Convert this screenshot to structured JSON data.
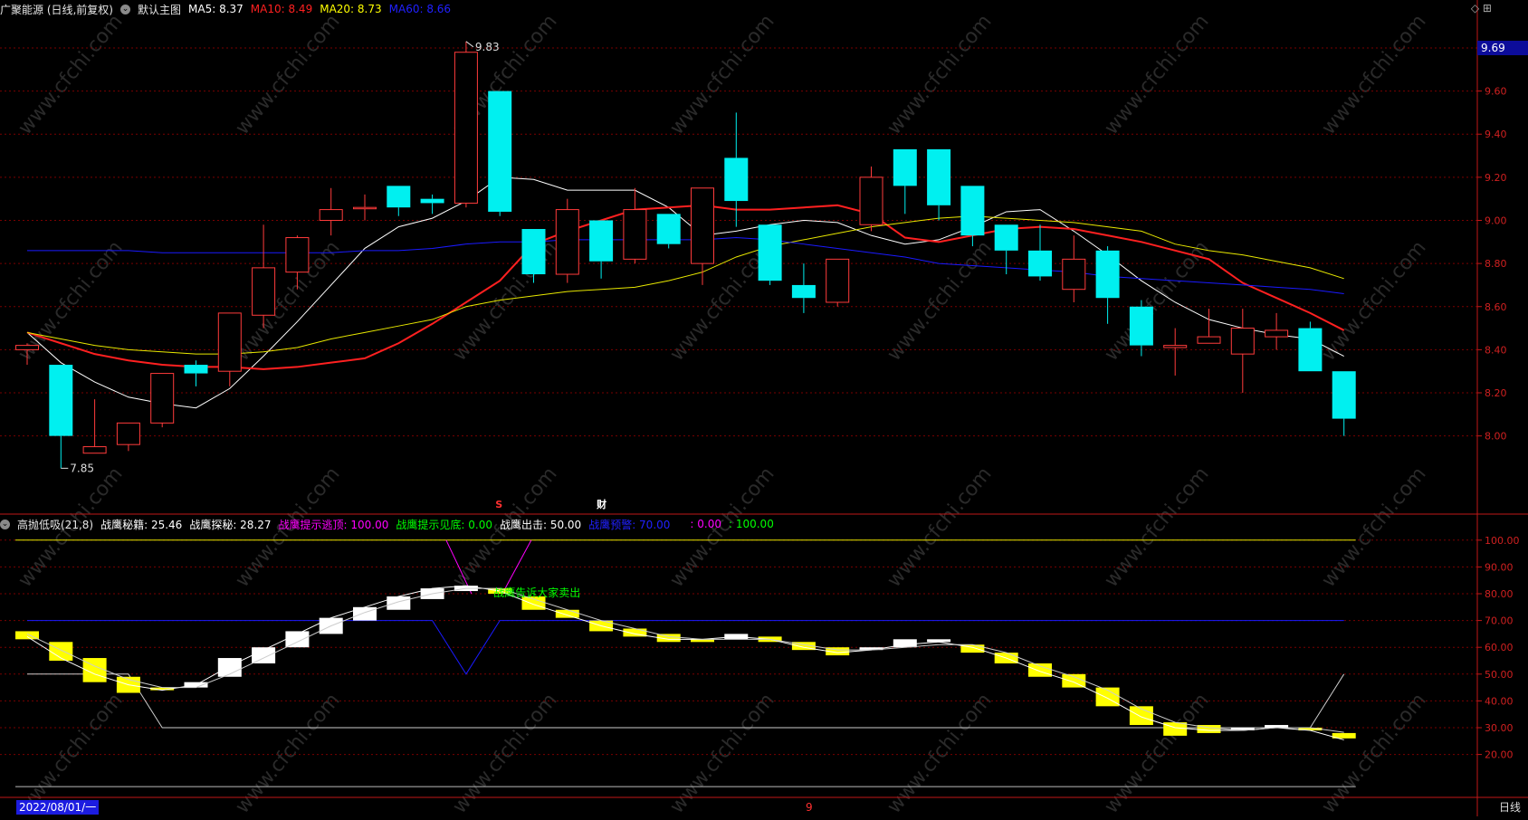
{
  "header": {
    "stock_title": "广聚能源 (日线,前复权)",
    "main_chart_label": "默认主图",
    "ma": [
      {
        "label": "MA5: 8.37",
        "color": "#ffffff"
      },
      {
        "label": "MA10: 8.49",
        "color": "#ff2020"
      },
      {
        "label": "MA20: 8.73",
        "color": "#ffff00"
      },
      {
        "label": "MA60: 8.66",
        "color": "#2020ff"
      }
    ]
  },
  "indicator_header": {
    "name": "高抛低吸(21,8)",
    "items": [
      {
        "label": "战鹰秘籍: 25.46",
        "color": "#ffffff"
      },
      {
        "label": "战鹰探秘: 28.27",
        "color": "#ffffff"
      },
      {
        "label": "战鹰提示逃顶: 100.00",
        "color": "#ff00ff"
      },
      {
        "label": "战鹰提示见底: 0.00",
        "color": "#00ff00"
      },
      {
        "label": "战鹰出击: 50.00",
        "color": "#ffffff"
      },
      {
        "label": "战鹰预警: 70.00",
        "color": "#2020ff"
      },
      {
        "label": ": 0.00",
        "color": "#ff00ff"
      },
      {
        "label": ": 100.00",
        "color": "#00ff00"
      }
    ]
  },
  "footer": {
    "date": "2022/08/01/一",
    "period": "日线",
    "month_mark": "9"
  },
  "current_price_tag": "9.69",
  "top_icons": "◇ ⊞",
  "watermark": "www.cfchi.com",
  "colors": {
    "up": "#ff3b3b",
    "down": "#00f0f0",
    "grid": "#7a0000",
    "axis": "#c01818",
    "ma5": "#ffffff",
    "ma10": "#ff2020",
    "ma20": "#e8e800",
    "ma60": "#1a1aff"
  },
  "chart_data": [
    {
      "type": "candlestick",
      "title": "广聚能源 (日线,前复权)",
      "ylim": [
        7.65,
        9.93
      ],
      "yticks": [
        8.0,
        8.2,
        8.4,
        8.6,
        8.8,
        9.0,
        9.2,
        9.4,
        9.6,
        9.8
      ],
      "annotations": [
        {
          "text": "9.83",
          "index": 13,
          "value": 9.83,
          "kind": "high"
        },
        {
          "text": "7.85",
          "index": 1,
          "value": 7.85,
          "kind": "low"
        },
        {
          "text": "S",
          "index": 14,
          "color": "#ff3030"
        },
        {
          "text": "财",
          "index": 17,
          "color": "#ffffff"
        }
      ],
      "ohlc": [
        {
          "o": 8.4,
          "h": 8.43,
          "l": 8.33,
          "c": 8.42
        },
        {
          "o": 8.33,
          "h": 8.33,
          "l": 7.85,
          "c": 8.0
        },
        {
          "o": 7.92,
          "h": 8.17,
          "l": 7.92,
          "c": 7.95
        },
        {
          "o": 7.96,
          "h": 8.06,
          "l": 7.93,
          "c": 8.06
        },
        {
          "o": 8.06,
          "h": 8.29,
          "l": 8.04,
          "c": 8.29
        },
        {
          "o": 8.33,
          "h": 8.35,
          "l": 8.23,
          "c": 8.29
        },
        {
          "o": 8.3,
          "h": 8.57,
          "l": 8.23,
          "c": 8.57
        },
        {
          "o": 8.56,
          "h": 8.98,
          "l": 8.5,
          "c": 8.78
        },
        {
          "o": 8.76,
          "h": 8.93,
          "l": 8.68,
          "c": 8.92
        },
        {
          "o": 9.0,
          "h": 9.15,
          "l": 8.93,
          "c": 9.05
        },
        {
          "o": 9.06,
          "h": 9.12,
          "l": 9.0,
          "c": 9.06
        },
        {
          "o": 9.16,
          "h": 9.16,
          "l": 9.02,
          "c": 9.06
        },
        {
          "o": 9.1,
          "h": 9.12,
          "l": 9.03,
          "c": 9.08
        },
        {
          "o": 9.08,
          "h": 9.83,
          "l": 9.06,
          "c": 9.78
        },
        {
          "o": 9.6,
          "h": 9.6,
          "l": 9.02,
          "c": 9.04
        },
        {
          "o": 8.96,
          "h": 8.96,
          "l": 8.71,
          "c": 8.75
        },
        {
          "o": 8.75,
          "h": 9.1,
          "l": 8.71,
          "c": 9.05
        },
        {
          "o": 9.0,
          "h": 9.0,
          "l": 8.73,
          "c": 8.81
        },
        {
          "o": 8.82,
          "h": 9.15,
          "l": 8.8,
          "c": 9.05
        },
        {
          "o": 9.03,
          "h": 9.03,
          "l": 8.87,
          "c": 8.89
        },
        {
          "o": 8.8,
          "h": 9.15,
          "l": 8.7,
          "c": 9.15
        },
        {
          "o": 9.29,
          "h": 9.5,
          "l": 8.97,
          "c": 9.09
        },
        {
          "o": 8.98,
          "h": 8.98,
          "l": 8.7,
          "c": 8.72
        },
        {
          "o": 8.7,
          "h": 8.8,
          "l": 8.57,
          "c": 8.64
        },
        {
          "o": 8.62,
          "h": 8.82,
          "l": 8.6,
          "c": 8.82
        },
        {
          "o": 8.98,
          "h": 9.25,
          "l": 8.95,
          "c": 9.2
        },
        {
          "o": 9.33,
          "h": 9.33,
          "l": 9.03,
          "c": 9.16
        },
        {
          "o": 9.33,
          "h": 9.33,
          "l": 9.0,
          "c": 9.07
        },
        {
          "o": 9.16,
          "h": 9.16,
          "l": 8.88,
          "c": 8.93
        },
        {
          "o": 8.98,
          "h": 8.98,
          "l": 8.75,
          "c": 8.86
        },
        {
          "o": 8.86,
          "h": 8.98,
          "l": 8.72,
          "c": 8.74
        },
        {
          "o": 8.68,
          "h": 8.93,
          "l": 8.62,
          "c": 8.82
        },
        {
          "o": 8.86,
          "h": 8.88,
          "l": 8.52,
          "c": 8.64
        },
        {
          "o": 8.6,
          "h": 8.63,
          "l": 8.37,
          "c": 8.42
        },
        {
          "o": 8.41,
          "h": 8.5,
          "l": 8.28,
          "c": 8.42
        },
        {
          "o": 8.43,
          "h": 8.59,
          "l": 8.43,
          "c": 8.46
        },
        {
          "o": 8.38,
          "h": 8.59,
          "l": 8.2,
          "c": 8.5
        },
        {
          "o": 8.46,
          "h": 8.57,
          "l": 8.4,
          "c": 8.49
        },
        {
          "o": 8.5,
          "h": 8.53,
          "l": 8.3,
          "c": 8.3
        },
        {
          "o": 8.3,
          "h": 8.3,
          "l": 8.0,
          "c": 8.08
        }
      ],
      "series": [
        {
          "name": "MA5",
          "color": "#ffffff",
          "values": [
            8.48,
            8.34,
            8.25,
            8.18,
            8.15,
            8.13,
            8.22,
            8.37,
            8.53,
            8.7,
            8.87,
            8.97,
            9.01,
            9.09,
            9.2,
            9.19,
            9.14,
            9.14,
            9.14,
            9.06,
            8.93,
            8.95,
            8.98,
            9.0,
            8.99,
            8.93,
            8.89,
            8.91,
            8.97,
            9.04,
            9.05,
            8.95,
            8.84,
            8.72,
            8.62,
            8.54,
            8.5,
            8.47,
            8.45,
            8.37
          ]
        },
        {
          "name": "MA10",
          "color": "#ff2020",
          "values": [
            8.48,
            8.43,
            8.38,
            8.35,
            8.33,
            8.32,
            8.32,
            8.31,
            8.32,
            8.34,
            8.36,
            8.43,
            8.52,
            8.62,
            8.72,
            8.89,
            8.95,
            9.0,
            9.05,
            9.06,
            9.07,
            9.05,
            9.05,
            9.06,
            9.07,
            9.03,
            8.92,
            8.9,
            8.93,
            8.96,
            8.97,
            8.96,
            8.93,
            8.9,
            8.86,
            8.82,
            8.71,
            8.64,
            8.57,
            8.49
          ]
        },
        {
          "name": "MA20",
          "color": "#e8e800",
          "values": [
            8.48,
            8.45,
            8.42,
            8.4,
            8.39,
            8.38,
            8.38,
            8.39,
            8.41,
            8.45,
            8.48,
            8.51,
            8.54,
            8.6,
            8.63,
            8.65,
            8.67,
            8.68,
            8.69,
            8.72,
            8.76,
            8.83,
            8.88,
            8.91,
            8.94,
            8.97,
            8.99,
            9.01,
            9.02,
            9.01,
            9.0,
            8.99,
            8.97,
            8.95,
            8.89,
            8.86,
            8.84,
            8.81,
            8.78,
            8.73
          ]
        },
        {
          "name": "MA60",
          "color": "#1a1aff",
          "values": [
            8.86,
            8.86,
            8.86,
            8.86,
            8.85,
            8.85,
            8.85,
            8.85,
            8.85,
            8.85,
            8.86,
            8.86,
            8.87,
            8.89,
            8.9,
            8.9,
            8.91,
            8.91,
            8.91,
            8.91,
            8.91,
            8.92,
            8.91,
            8.89,
            8.87,
            8.85,
            8.83,
            8.8,
            8.79,
            8.78,
            8.77,
            8.76,
            8.74,
            8.73,
            8.72,
            8.71,
            8.7,
            8.69,
            8.68,
            8.66
          ]
        }
      ]
    },
    {
      "type": "indicator",
      "title": "高抛低吸(21,8)",
      "ylim": [
        5,
        105
      ],
      "yticks": [
        20.0,
        30.0,
        40.0,
        50.0,
        60.0,
        70.0,
        80.0,
        90.0,
        100.0
      ],
      "annotation": {
        "text": "战鹰告诉大家卖出",
        "index": 14,
        "value": 80,
        "color": "#00ff00"
      },
      "bars": [
        {
          "o": 63,
          "c": 66,
          "color": "yellow"
        },
        {
          "o": 62,
          "c": 55,
          "color": "yellow"
        },
        {
          "o": 56,
          "c": 47,
          "color": "yellow"
        },
        {
          "o": 49,
          "c": 43,
          "color": "yellow"
        },
        {
          "o": 45,
          "c": 44,
          "color": "yellow"
        },
        {
          "o": 45,
          "c": 47,
          "color": "white"
        },
        {
          "o": 49,
          "c": 56,
          "color": "white"
        },
        {
          "o": 54,
          "c": 60,
          "color": "white"
        },
        {
          "o": 60,
          "c": 66,
          "color": "white"
        },
        {
          "o": 65,
          "c": 71,
          "color": "white"
        },
        {
          "o": 70,
          "c": 75,
          "color": "white"
        },
        {
          "o": 74,
          "c": 79,
          "color": "white"
        },
        {
          "o": 78,
          "c": 82,
          "color": "white"
        },
        {
          "o": 81,
          "c": 83,
          "color": "white"
        },
        {
          "o": 82,
          "c": 80,
          "color": "yellow"
        },
        {
          "o": 79,
          "c": 74,
          "color": "yellow"
        },
        {
          "o": 74,
          "c": 71,
          "color": "yellow"
        },
        {
          "o": 70,
          "c": 66,
          "color": "yellow"
        },
        {
          "o": 67,
          "c": 64,
          "color": "yellow"
        },
        {
          "o": 65,
          "c": 62,
          "color": "yellow"
        },
        {
          "o": 63,
          "c": 63,
          "color": "yellow"
        },
        {
          "o": 63,
          "c": 65,
          "color": "white"
        },
        {
          "o": 64,
          "c": 62,
          "color": "yellow"
        },
        {
          "o": 62,
          "c": 59,
          "color": "yellow"
        },
        {
          "o": 60,
          "c": 57,
          "color": "yellow"
        },
        {
          "o": 59,
          "c": 60,
          "color": "white"
        },
        {
          "o": 60,
          "c": 63,
          "color": "white"
        },
        {
          "o": 62,
          "c": 63,
          "color": "white"
        },
        {
          "o": 61,
          "c": 58,
          "color": "yellow"
        },
        {
          "o": 58,
          "c": 54,
          "color": "yellow"
        },
        {
          "o": 54,
          "c": 49,
          "color": "yellow"
        },
        {
          "o": 50,
          "c": 45,
          "color": "yellow"
        },
        {
          "o": 45,
          "c": 38,
          "color": "yellow"
        },
        {
          "o": 38,
          "c": 31,
          "color": "yellow"
        },
        {
          "o": 32,
          "c": 27,
          "color": "yellow"
        },
        {
          "o": 31,
          "c": 28,
          "color": "yellow"
        },
        {
          "o": 29,
          "c": 30,
          "color": "white"
        },
        {
          "o": 30,
          "c": 31,
          "color": "white"
        },
        {
          "o": 30,
          "c": 29,
          "color": "yellow"
        },
        {
          "o": 28,
          "c": 26,
          "color": "yellow"
        }
      ],
      "series": [
        {
          "name": "战鹰秘籍",
          "color": "#ffffff",
          "values": [
            64,
            56,
            50,
            46,
            44,
            46,
            53,
            59,
            65,
            71,
            75,
            79,
            82,
            83,
            81,
            76,
            72,
            68,
            65,
            63,
            63,
            64,
            63,
            60,
            58,
            59,
            61,
            62,
            60,
            56,
            51,
            47,
            41,
            34,
            30,
            29,
            29,
            30,
            29,
            25.46
          ]
        },
        {
          "name": "战鹰探秘",
          "color": "#cccccc",
          "values": [
            65,
            59,
            53,
            48,
            45,
            45,
            50,
            56,
            62,
            68,
            73,
            77,
            80,
            82,
            82,
            78,
            74,
            70,
            67,
            64,
            63,
            63,
            63,
            61,
            59,
            59,
            60,
            61,
            61,
            58,
            53,
            49,
            44,
            37,
            32,
            30,
            29,
            30,
            30,
            28.27
          ]
        },
        {
          "name": "战鹰出击",
          "color": "#ffffff",
          "values": [
            50,
            50,
            50,
            50,
            30,
            30,
            30,
            30,
            30,
            30,
            30,
            30,
            30,
            30,
            30,
            30,
            30,
            30,
            30,
            30,
            30,
            30,
            30,
            30,
            30,
            30,
            30,
            30,
            30,
            30,
            30,
            30,
            30,
            30,
            30,
            30,
            30,
            30,
            30,
            50
          ]
        },
        {
          "name": "战鹰预警",
          "color": "#1a1aff",
          "values": [
            70,
            70,
            70,
            70,
            70,
            70,
            70,
            70,
            70,
            70,
            70,
            70,
            70,
            50,
            70,
            70,
            70,
            70,
            70,
            70,
            70,
            70,
            70,
            70,
            70,
            70,
            70,
            70,
            70,
            70,
            70,
            70,
            70,
            70,
            70,
            70,
            70,
            70,
            70,
            70
          ]
        },
        {
          "name": "战鹰提示逃顶",
          "color": "#ff00ff",
          "values": [
            100,
            100,
            100,
            100,
            100,
            100,
            100,
            100,
            100,
            100,
            100,
            100,
            100,
            100,
            100,
            100,
            100,
            100,
            100,
            100,
            100,
            100,
            100,
            100,
            100,
            100,
            100,
            100,
            100,
            100,
            100,
            100,
            100,
            100,
            100,
            100,
            100,
            100,
            100,
            100
          ]
        },
        {
          "name": "战鹰提示见底",
          "color": "#00ff00",
          "values": [
            0,
            0,
            0,
            0,
            0,
            0,
            0,
            0,
            0,
            0,
            0,
            0,
            0,
            0,
            0,
            0,
            0,
            0,
            0,
            0,
            0,
            0,
            0,
            0,
            0,
            0,
            0,
            0,
            0,
            0,
            0,
            0,
            0,
            0,
            0,
            0,
            0,
            0,
            0,
            0
          ]
        }
      ]
    }
  ]
}
